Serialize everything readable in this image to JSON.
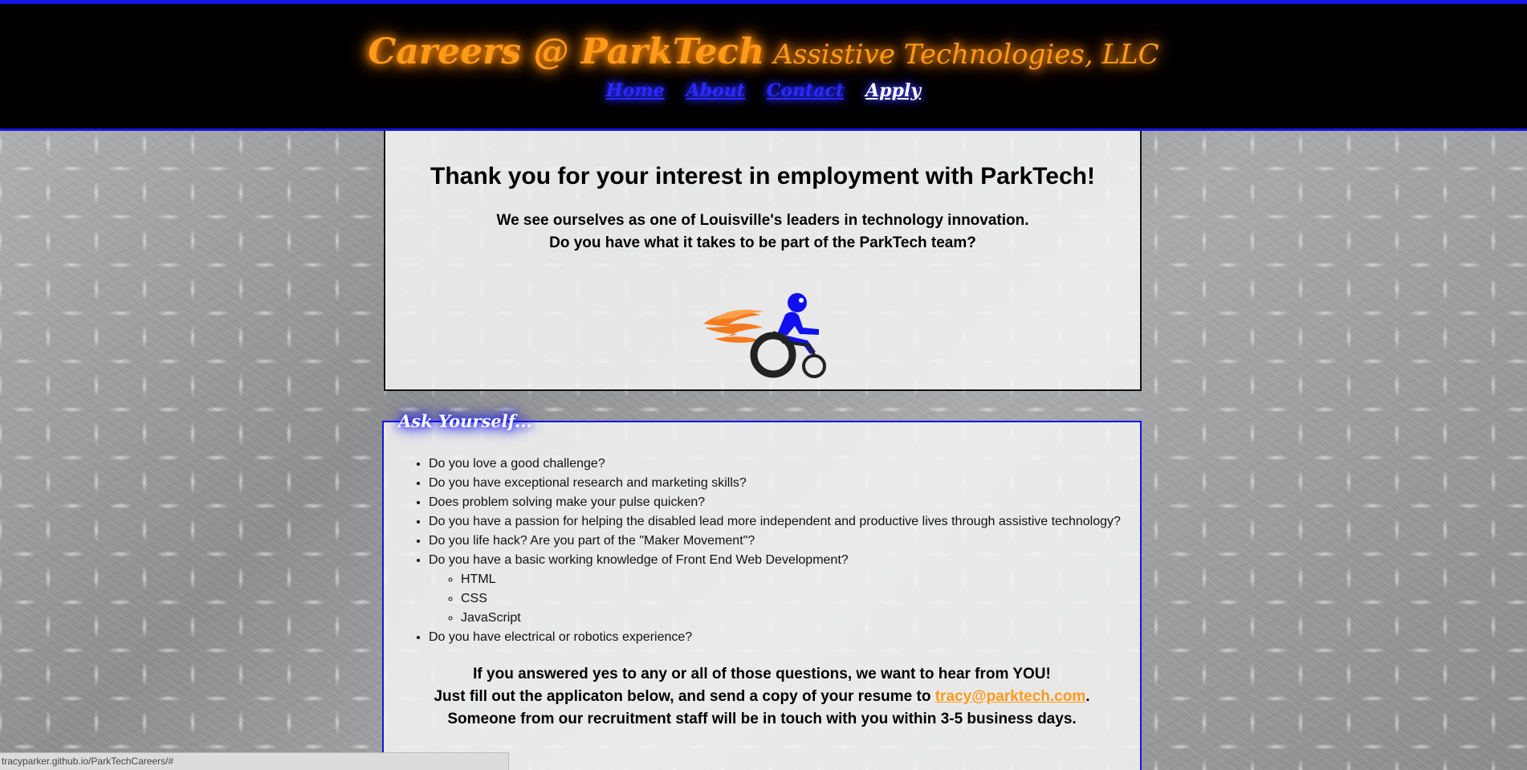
{
  "header": {
    "title_main": "Careers @ ParkTech",
    "title_sub": "Assistive Technologies, LLC",
    "nav": [
      {
        "label": "Home"
      },
      {
        "label": "About"
      },
      {
        "label": "Contact"
      },
      {
        "label": "Apply"
      }
    ],
    "active_nav": "Apply"
  },
  "intro": {
    "heading": "Thank you for your interest in employment with ParkTech!",
    "line1": "We see ourselves as one of Louisville's leaders in technology innovation.",
    "line2": "Do you have what it takes to be part of the ParkTech team?",
    "logo_icon": "wheelchair-racer-icon"
  },
  "ask": {
    "legend": "Ask Yourself...",
    "questions": [
      "Do you love a good challenge?",
      "Do you have exceptional research and marketing skills?",
      "Does problem solving make your pulse quicken?",
      "Do you have a passion for helping the disabled lead more independent and productive lives through assistive technology?",
      "Do you life hack? Are you part of the \"Maker Movement\"?",
      "Do you have a basic working knowledge of Front End Web Development?",
      "Do you have electrical or robotics experience?"
    ],
    "subskills": [
      "HTML",
      "CSS",
      "JavaScript"
    ],
    "closing_line1": "If you answered yes to any or all of those questions, we want to hear from YOU!",
    "closing_line2_pre": "Just fill out the applicaton below, and send a copy of your resume to",
    "email": "tracy@parktech.com",
    "closing_line2_post": ".",
    "closing_line3": "Someone from our recruitment staff will be in touch with you within 3-5 business days."
  },
  "status_bar": {
    "url": "tracyparker.github.io/ParkTechCareers/#"
  },
  "colors": {
    "accent_orange": "#ff9a1a",
    "accent_blue": "#1414e6",
    "header_bg": "#000000"
  }
}
